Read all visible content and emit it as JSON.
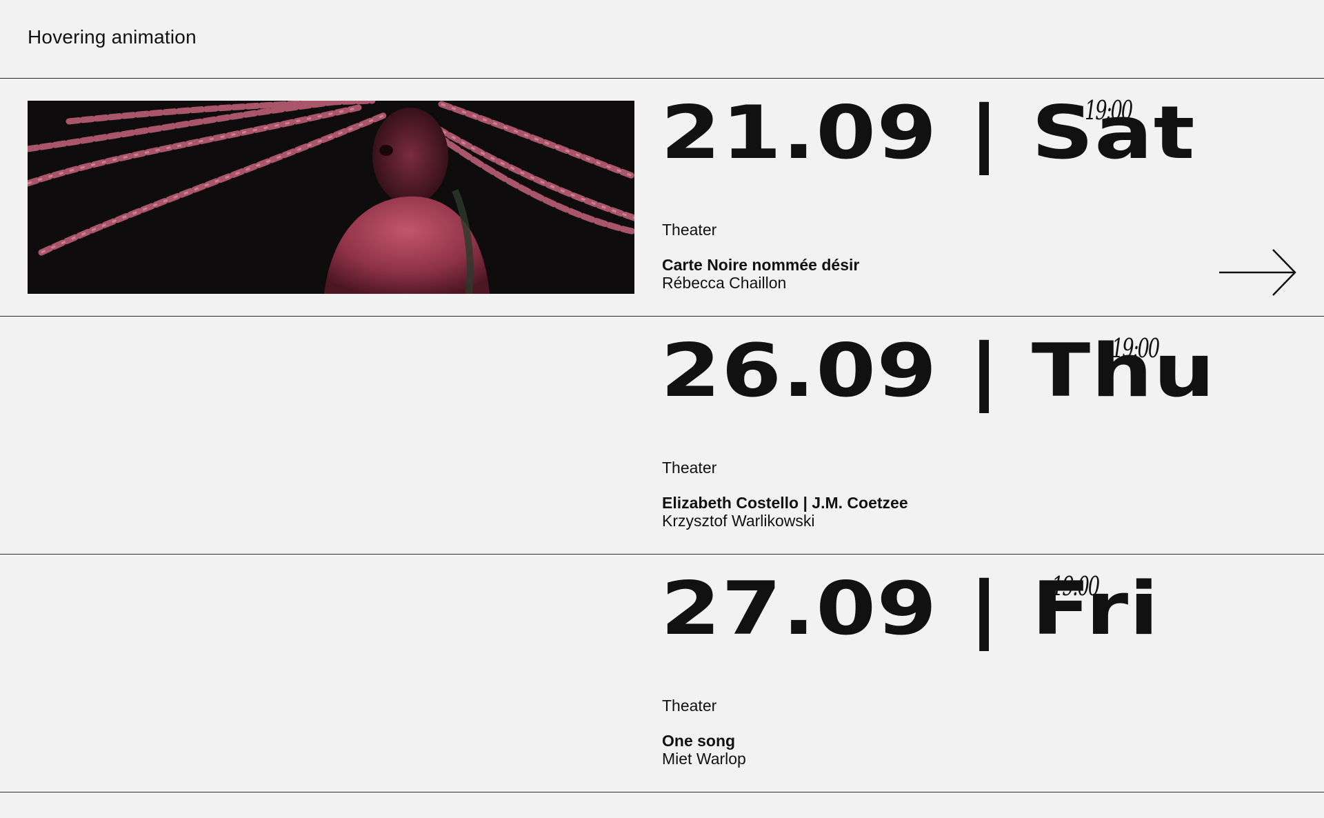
{
  "header": {
    "title": "Hovering animation"
  },
  "events": [
    {
      "date": "21.09 | Sat",
      "time": "19:00",
      "category": "Theater",
      "title": "Carte Noire nommée désir",
      "author": "Rébecca Chaillon",
      "has_image": true,
      "arrow_icon": "arrow-right-icon"
    },
    {
      "date": "26.09 | Thu",
      "time": "19:00",
      "category": "Theater",
      "title": "Elizabeth Costello | J.M. Coetzee",
      "author": "Krzysztof Warlikowski",
      "has_image": false
    },
    {
      "date": "27.09 | Fri",
      "time": "19:00",
      "category": "Theater",
      "title": "One song",
      "author": "Miet Warlop",
      "has_image": false
    }
  ],
  "colors": {
    "background": "#f2f2f2",
    "text": "#111111",
    "divider": "#2a2a2a",
    "image_tint": "#a8475a"
  }
}
